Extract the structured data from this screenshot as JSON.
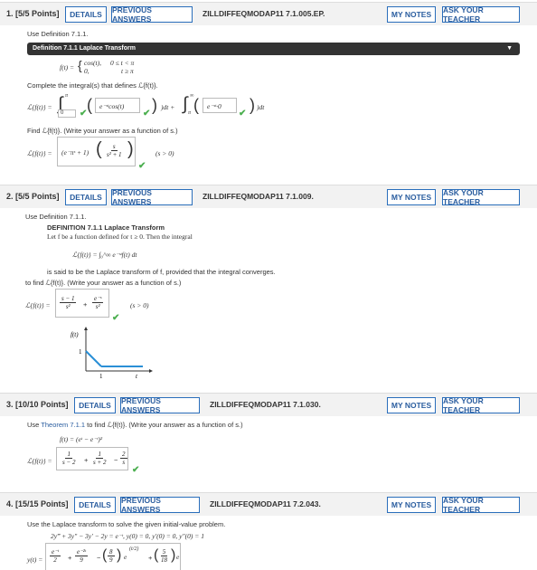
{
  "questions": [
    {
      "number": "1. [5/5 Points]",
      "details": "DETAILS",
      "prev": "PREVIOUS ANSWERS",
      "code": "ZILLDIFFEQMODAP11 7.1.005.EP.",
      "notes": "MY NOTES",
      "ask": "ASK YOUR TEACHER",
      "use_def": "Use Definition 7.1.1.",
      "def_bar": "Definition 7.1.1 Laplace Transform",
      "f_label": "f(t) =",
      "case1": "cos(t),",
      "case1_cond": "0 ≤ t < π",
      "case2": "0,",
      "case2_cond": "t ≥ π",
      "complete": "Complete the integral(s) that defines ℒ{f(t)}.",
      "lhs": "ℒ{f(t)} =",
      "int1_upper": "π",
      "int1_lower": "0",
      "int1_integrand": "e⁻ˢᵗcos(t)",
      "dt_plus": ")dt +",
      "int2_upper": "∞",
      "int2_lower": "π",
      "int2_integrand": "e⁻ˢᵗ·0",
      "dt": ")dt",
      "find": "Find ℒ{f(t)}. (Write your answer as a function of s.)",
      "ans_lhs": "ℒ{f(t)} =",
      "ans_part1": "(e⁻πˢ + 1)",
      "ans_num": "s",
      "ans_den": "s² + 1",
      "cond": "(s > 0)"
    },
    {
      "number": "2. [5/5 Points]",
      "details": "DETAILS",
      "prev": "PREVIOUS ANSWERS",
      "code": "ZILLDIFFEQMODAP11 7.1.009.",
      "notes": "MY NOTES",
      "ask": "ASK YOUR TEACHER",
      "use_def": "Use Definition 7.1.1.",
      "def_title": "DEFINITION 7.1.1   Laplace Transform",
      "def_line": "Let f be a function defined for t ≥ 0. Then the integral",
      "def_formula": "ℒ{f(t)} = ∫₀^∞ e⁻ˢᵗf(t) dt",
      "def_said": "is said to be the Laplace transform of f, provided that the integral converges.",
      "find": "to find ℒ{f(t)}. (Write your answer as a function of s.)",
      "ans_lhs": "ℒ{f(t)} =",
      "f1_num": "s − 1",
      "f1_den": "s²",
      "f2_num": "e⁻ˢ",
      "f2_den": "s²",
      "cond": "(s > 0)",
      "graph_ylabel": "f(t)",
      "graph_tick_y": "1",
      "graph_tick_x": "1",
      "graph_xlabel": "t"
    },
    {
      "number": "3. [10/10 Points]",
      "details": "DETAILS",
      "prev": "PREVIOUS ANSWERS",
      "code": "ZILLDIFFEQMODAP11 7.1.030.",
      "notes": "MY NOTES",
      "ask": "ASK YOUR TEACHER",
      "use_prefix": "Use",
      "use_link": "Theorem 7.1.1",
      "use_suffix": "to find ℒ{f(t)}. (Write your answer as a function of s.)",
      "f_def": "f(t) = (eᵗ − e⁻ᵗ)²",
      "ans_lhs": "ℒ{f(t)} =",
      "t1_num": "1",
      "t1_den": "s − 2",
      "t2_num": "1",
      "t2_den": "s + 2",
      "t3_num": "2",
      "t3_den": "s"
    },
    {
      "number": "4. [15/15 Points]",
      "details": "DETAILS",
      "prev": "PREVIOUS ANSWERS",
      "code": "ZILLDIFFEQMODAP11 7.2.043.",
      "notes": "MY NOTES",
      "ask": "ASK YOUR TEACHER",
      "instruction": "Use the Laplace transform to solve the given initial-value problem.",
      "ode": "2y‴ + 3y″ − 3y′ − 2y = e⁻ᵗ,   y(0) = 0,   y′(0) = 0,   y″(0) = 1",
      "ans_lhs": "y(t) =",
      "a1_num": "e⁻ᵗ",
      "a1_den": "2",
      "a2_num": "e⁻²ᵗ",
      "a2_den": "9",
      "a3_num": "8",
      "a3_den": "9",
      "a3_exp": "(t/2)",
      "a4_num": "5",
      "a4_den": "18"
    }
  ],
  "colors": {
    "accent": "#2a5d9f",
    "check": "#4caf50",
    "header_bg": "#f2f2f2",
    "graph_line": "#2a8fd6"
  }
}
